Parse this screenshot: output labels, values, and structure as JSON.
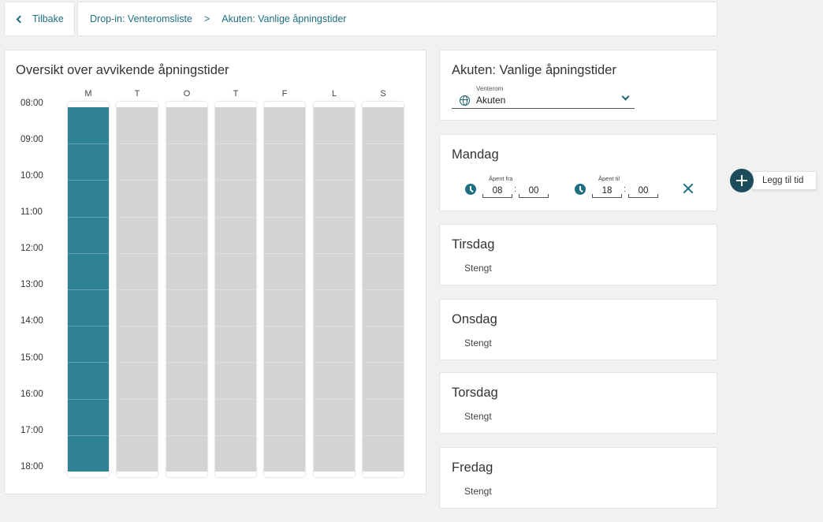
{
  "breadcrumb": {
    "back_label": "Tilbake",
    "items": [
      "Drop-in: Venteromsliste",
      "Akuten: Vanlige åpningstider"
    ],
    "separator": ">"
  },
  "schedule": {
    "title": "Oversikt over avvikende åpningstider",
    "days": [
      "M",
      "T",
      "O",
      "T",
      "F",
      "L",
      "S"
    ],
    "hours": [
      "08:00",
      "09:00",
      "10:00",
      "11:00",
      "12:00",
      "13:00",
      "14:00",
      "15:00",
      "16:00",
      "17:00",
      "18:00"
    ],
    "open_days": [
      true,
      false,
      false,
      false,
      false,
      false,
      false
    ],
    "colors": {
      "open": "#2e8293",
      "closed": "#d3d3d3"
    }
  },
  "akuten": {
    "title": "Akuten: Vanlige åpningstider",
    "venterom_label": "Venterom",
    "venterom_value": "Akuten"
  },
  "mandag": {
    "title": "Mandag",
    "open_from_label": "Åpent fra",
    "open_from_hour": "08",
    "open_from_minute": "00",
    "open_to_label": "Åpent til",
    "open_to_hour": "18",
    "open_to_minute": "00",
    "colon": ":"
  },
  "closed_days": [
    {
      "title": "Tirsdag",
      "status": "Stengt"
    },
    {
      "title": "Onsdag",
      "status": "Stengt"
    },
    {
      "title": "Torsdag",
      "status": "Stengt"
    },
    {
      "title": "Fredag",
      "status": "Stengt"
    }
  ],
  "add_time_label": "Legg til tid"
}
